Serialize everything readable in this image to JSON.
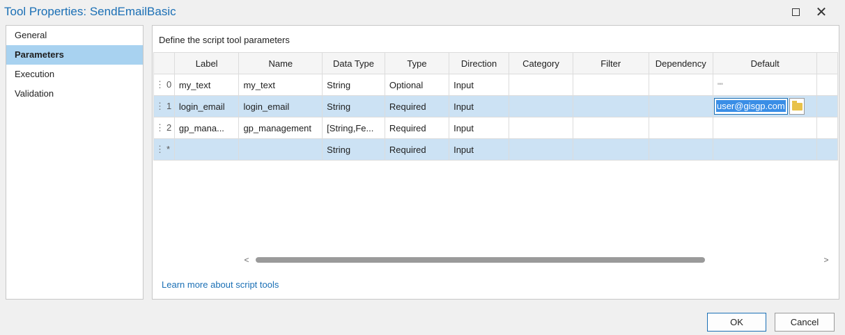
{
  "window": {
    "title": "Tool Properties: SendEmailBasic",
    "maximize_icon": "maximize-icon",
    "close_label": "✕"
  },
  "sidebar": {
    "items": [
      {
        "label": "General",
        "active": false
      },
      {
        "label": "Parameters",
        "active": true
      },
      {
        "label": "Execution",
        "active": false
      },
      {
        "label": "Validation",
        "active": false
      }
    ]
  },
  "main": {
    "define_label": "Define the script tool parameters",
    "columns": [
      "Label",
      "Name",
      "Data Type",
      "Type",
      "Direction",
      "Category",
      "Filter",
      "Dependency",
      "Default"
    ],
    "rows": [
      {
        "index": "0",
        "label": "my_text",
        "name": "my_text",
        "data_type": "String",
        "type": "Optional",
        "direction": "Input",
        "category": "",
        "filter": "",
        "dependency": "",
        "default": "\"\""
      },
      {
        "index": "1",
        "label": "login_email",
        "name": "login_email",
        "data_type": "String",
        "type": "Required",
        "direction": "Input",
        "category": "",
        "filter": "",
        "dependency": "",
        "default": "user@gisgp.com"
      },
      {
        "index": "2",
        "label": "gp_mana...",
        "name": "gp_management",
        "data_type": "[String,Fe...",
        "type": "Required",
        "direction": "Input",
        "category": "",
        "filter": "",
        "dependency": "",
        "default": ""
      },
      {
        "index": "*",
        "label": "",
        "name": "",
        "data_type": "String",
        "type": "Required",
        "direction": "Input",
        "category": "",
        "filter": "",
        "dependency": "",
        "default": ""
      }
    ],
    "learn_more": "Learn more about script tools"
  },
  "footer": {
    "ok_label": "OK",
    "cancel_label": "Cancel"
  },
  "colors": {
    "accent": "#1a6fb5",
    "selected_row": "#cce2f4",
    "active_nav": "#a8d2f0"
  }
}
